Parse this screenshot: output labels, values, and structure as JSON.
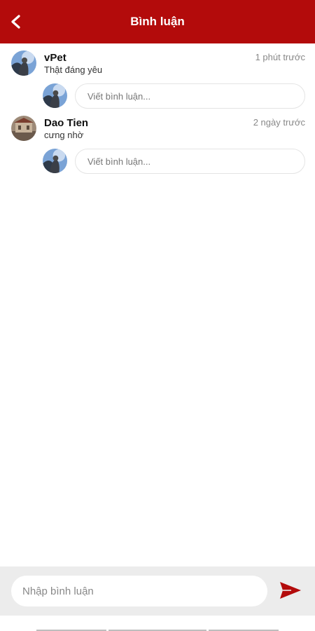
{
  "header": {
    "title": "Bình luận",
    "back_icon": "chevron-left-icon",
    "background": "#b30b0b"
  },
  "comments": [
    {
      "author": "vPet",
      "time": "1 phút trước",
      "text": "Thật đáng yêu",
      "avatar": "avatar-photo",
      "reply_placeholder": "Viết bình luận..."
    },
    {
      "author": "Dao Tien",
      "time": "2 ngày trước",
      "text": "cưng nhờ",
      "avatar": "avatar-photo",
      "reply_placeholder": "Viết bình luận..."
    }
  ],
  "composer": {
    "placeholder": "Nhập bình luận",
    "send_icon": "send-icon",
    "accent": "#b30b0b"
  }
}
